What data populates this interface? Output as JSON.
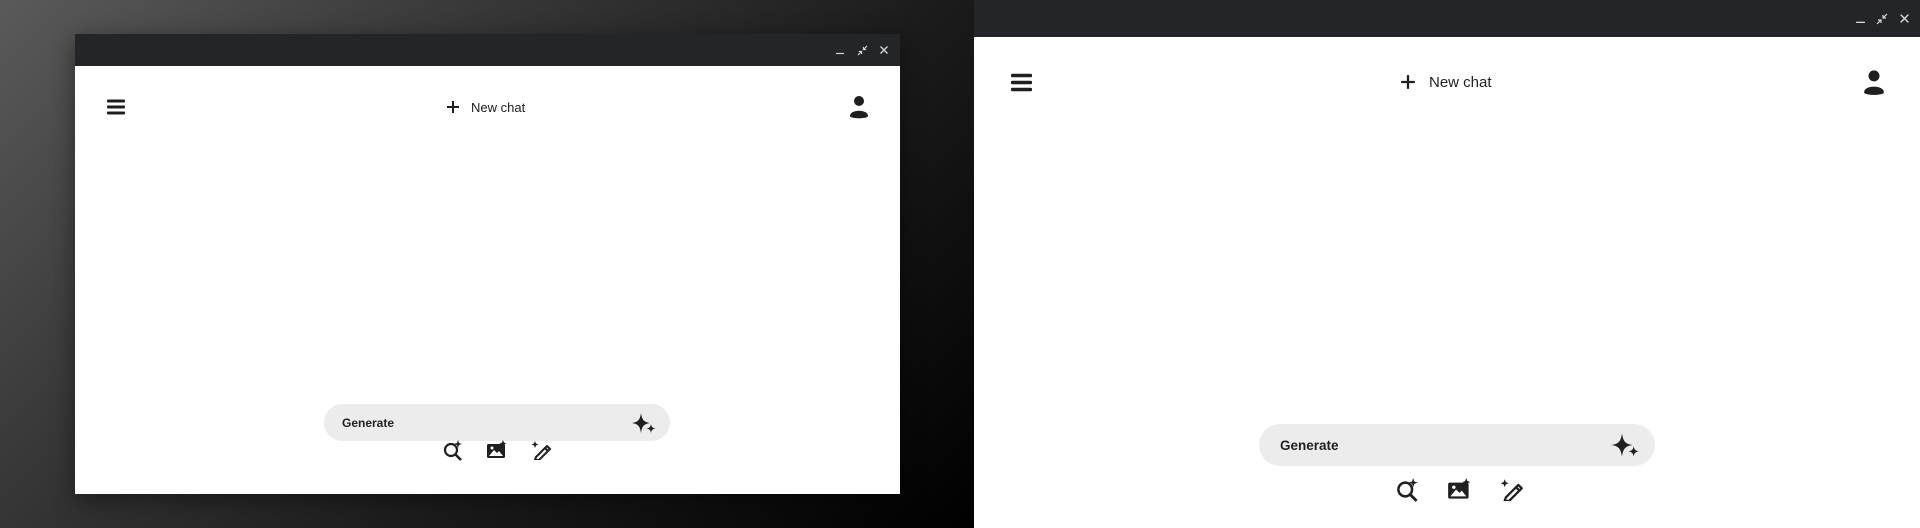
{
  "header": {
    "new_chat_label": "New chat"
  },
  "prompt": {
    "placeholder": "Generate"
  },
  "icons": {
    "menu": "hamburger-menu-icon",
    "new_chat": "plus-icon",
    "profile": "user-profile-icon",
    "generate": "sparkle-icon",
    "tools": [
      "search-sparkle-icon",
      "image-sparkle-icon",
      "pen-sparkle-icon"
    ],
    "window_controls": [
      "minimize-icon",
      "restore-icon",
      "close-icon"
    ]
  },
  "colors": {
    "titlebar": "#232529",
    "prompt_bg": "#ececec",
    "icon": "#1f1f1f"
  }
}
